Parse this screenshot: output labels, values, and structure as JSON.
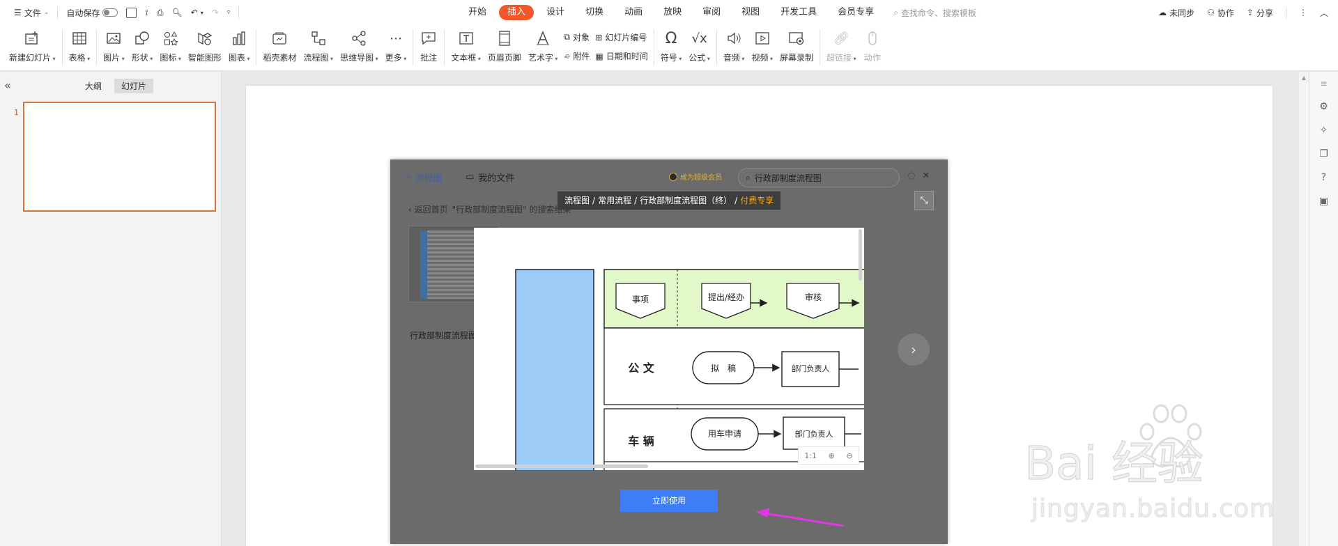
{
  "menubar": {
    "file": "文件",
    "autosave": "自动保存",
    "tabs": [
      "开始",
      "插入",
      "设计",
      "切换",
      "动画",
      "放映",
      "审阅",
      "视图",
      "开发工具",
      "会员专享"
    ],
    "active_tab": "插入",
    "search_placeholder": "查找命令、搜索模板",
    "sync": "未同步",
    "collab": "协作",
    "share": "分享"
  },
  "ribbon": {
    "new_slide": "新建幻灯片",
    "table": "表格",
    "picture": "图片",
    "shape": "形状",
    "icon": "图标",
    "smart_graphic": "智能图形",
    "chart": "图表",
    "docer": "稻壳素材",
    "flowchart": "流程图",
    "mindmap": "思维导图",
    "more": "更多",
    "comment": "批注",
    "textbox": "文本框",
    "header_footer": "页眉页脚",
    "wordart": "艺术字",
    "object": "对象",
    "slide_number": "幻灯片编号",
    "attachment": "附件",
    "datetime": "日期和时间",
    "symbol": "符号",
    "formula": "公式",
    "audio": "音频",
    "video": "视频",
    "screen_record": "屏幕录制",
    "hyperlink": "超链接",
    "action": "动作"
  },
  "leftpanel": {
    "tab_outline": "大纲",
    "tab_slides": "幻灯片",
    "slide_number": "1"
  },
  "dialog": {
    "tab_flowchart": "流程图",
    "tab_myfiles": "我的文件",
    "vip": "成为超级会员",
    "search_value": "行政部制度流程图",
    "back_home": "返回首页",
    "search_result": "\"行政部制度流程图\" 的搜索结果",
    "thumb_label": "行政部制度流程图",
    "breadcrumb": [
      "流程图",
      "常用流程",
      "行政部制度流程图（终）"
    ],
    "breadcrumb_tag": "付费专享",
    "use_now": "立即使用",
    "zoom_fit": "1:1"
  },
  "flowchart": {
    "header_items": [
      "事项",
      "提出/经办",
      "审核"
    ],
    "row1_label": "公 文",
    "row1_items": [
      "拟　稿",
      "部门负责人"
    ],
    "row2_label": "车 辆",
    "row2_items": [
      "用车申请",
      "部门负责人"
    ],
    "header_bg": "#e2f8c8",
    "side_bar_color": "#9dcbf8"
  },
  "watermark": {
    "brand": "Bai 经验",
    "url": "jingyan.baidu.com"
  },
  "colors": {
    "accent": "#f2572c",
    "primary_button": "#3d7df6",
    "annotation_arrow": "#e436e4"
  }
}
